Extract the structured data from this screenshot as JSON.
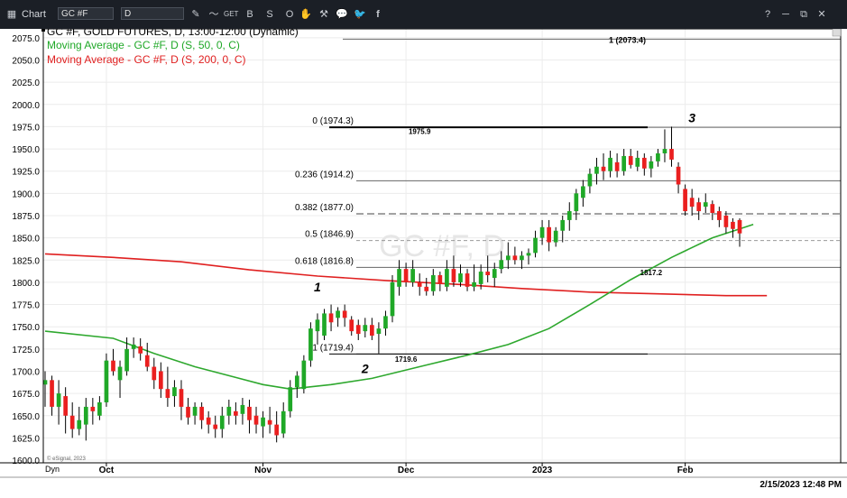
{
  "toolbar": {
    "window_title": "Chart",
    "symbol_value": "GC #F",
    "interval_value": "D",
    "icon_names": [
      "chart-app-icon",
      "pencil-icon",
      "wave-icon",
      "get-icon",
      "b-icon",
      "s-icon",
      "o-icon",
      "hand-icon",
      "tool-icon",
      "comment-icon",
      "twitter-icon",
      "facebook-icon"
    ],
    "icon_labels": [
      "✎",
      "〜",
      "GET",
      "B",
      "S",
      "O",
      "✋",
      "⚒",
      "💬",
      "🐦",
      "f"
    ],
    "window_icons": [
      "?",
      "─",
      "⧉",
      "✕"
    ]
  },
  "legend": {
    "price_line": "GC #F, GOLD FUTURES, D, 13:00-12:00 (Dynamic)",
    "ma50_line": "Moving Average - GC #F, D (S, 50, 0, C)",
    "ma200_line": "Moving Average - GC #F, D (S, 200, 0, C)"
  },
  "footer": {
    "timestamp": "2/15/2023 12:48 PM",
    "copyright": "© eSignal, 2023",
    "dyn_label": "Dyn"
  },
  "colors": {
    "up": "#1fa827",
    "down": "#ea1f1f",
    "ma50": "#2ea82e",
    "ma200": "#e02020",
    "toolbar_bg": "#1b1f26"
  },
  "chart_data": {
    "type": "candlestick",
    "title": "GC #F, GOLD FUTURES, D, 13:00-12:00 (Dynamic)",
    "watermark": "GC #F, D",
    "ylim": [
      1597,
      2085
    ],
    "y_ticks": [
      1600,
      1625,
      1650,
      1675,
      1700,
      1725,
      1750,
      1775,
      1800,
      1825,
      1850,
      1875,
      1900,
      1925,
      1950,
      1975,
      2000,
      2025,
      2050,
      2075
    ],
    "y_tick_labels": [
      "1600.0",
      "1625.0",
      "1650.0",
      "1675.0",
      "1700.0",
      "1725.0",
      "1750.0",
      "1775.0",
      "1800.0",
      "1825.0",
      "1850.0",
      "1875.0",
      "1900.0",
      "1925.0",
      "1950.0",
      "1975.0",
      "2000.0",
      "2025.0",
      "2050.0",
      "2075.0"
    ],
    "x_labels": [
      {
        "label": "Oct",
        "index": 9
      },
      {
        "label": "Nov",
        "index": 32
      },
      {
        "label": "Dec",
        "index": 53
      },
      {
        "label": "2023",
        "index": 73
      },
      {
        "label": "Feb",
        "index": 94
      }
    ],
    "candles": [
      {
        "o": 1685,
        "h": 1700,
        "l": 1660,
        "c": 1690
      },
      {
        "o": 1690,
        "h": 1695,
        "l": 1650,
        "c": 1660
      },
      {
        "o": 1660,
        "h": 1690,
        "l": 1640,
        "c": 1675
      },
      {
        "o": 1672,
        "h": 1682,
        "l": 1630,
        "c": 1650
      },
      {
        "o": 1650,
        "h": 1665,
        "l": 1625,
        "c": 1635
      },
      {
        "o": 1635,
        "h": 1660,
        "l": 1628,
        "c": 1645
      },
      {
        "o": 1640,
        "h": 1670,
        "l": 1622,
        "c": 1660
      },
      {
        "o": 1660,
        "h": 1670,
        "l": 1640,
        "c": 1655
      },
      {
        "o": 1650,
        "h": 1672,
        "l": 1645,
        "c": 1665
      },
      {
        "o": 1665,
        "h": 1720,
        "l": 1660,
        "c": 1712
      },
      {
        "o": 1712,
        "h": 1725,
        "l": 1695,
        "c": 1700
      },
      {
        "o": 1690,
        "h": 1712,
        "l": 1670,
        "c": 1705
      },
      {
        "o": 1700,
        "h": 1738,
        "l": 1695,
        "c": 1725
      },
      {
        "o": 1725,
        "h": 1738,
        "l": 1715,
        "c": 1730
      },
      {
        "o": 1728,
        "h": 1737,
        "l": 1712,
        "c": 1720
      },
      {
        "o": 1718,
        "h": 1732,
        "l": 1700,
        "c": 1705
      },
      {
        "o": 1705,
        "h": 1715,
        "l": 1680,
        "c": 1690
      },
      {
        "o": 1700,
        "h": 1710,
        "l": 1670,
        "c": 1680
      },
      {
        "o": 1680,
        "h": 1705,
        "l": 1660,
        "c": 1670
      },
      {
        "o": 1672,
        "h": 1690,
        "l": 1660,
        "c": 1682
      },
      {
        "o": 1680,
        "h": 1690,
        "l": 1645,
        "c": 1660
      },
      {
        "o": 1660,
        "h": 1670,
        "l": 1640,
        "c": 1648
      },
      {
        "o": 1650,
        "h": 1665,
        "l": 1640,
        "c": 1660
      },
      {
        "o": 1660,
        "h": 1665,
        "l": 1635,
        "c": 1645
      },
      {
        "o": 1648,
        "h": 1655,
        "l": 1630,
        "c": 1640
      },
      {
        "o": 1640,
        "h": 1650,
        "l": 1625,
        "c": 1635
      },
      {
        "o": 1635,
        "h": 1660,
        "l": 1625,
        "c": 1650
      },
      {
        "o": 1650,
        "h": 1668,
        "l": 1640,
        "c": 1660
      },
      {
        "o": 1655,
        "h": 1665,
        "l": 1640,
        "c": 1650
      },
      {
        "o": 1652,
        "h": 1670,
        "l": 1640,
        "c": 1662
      },
      {
        "o": 1660,
        "h": 1668,
        "l": 1630,
        "c": 1645
      },
      {
        "o": 1650,
        "h": 1660,
        "l": 1630,
        "c": 1640
      },
      {
        "o": 1638,
        "h": 1655,
        "l": 1625,
        "c": 1648
      },
      {
        "o": 1645,
        "h": 1660,
        "l": 1630,
        "c": 1640
      },
      {
        "o": 1640,
        "h": 1655,
        "l": 1620,
        "c": 1628
      },
      {
        "o": 1630,
        "h": 1665,
        "l": 1625,
        "c": 1655
      },
      {
        "o": 1655,
        "h": 1690,
        "l": 1648,
        "c": 1682
      },
      {
        "o": 1682,
        "h": 1700,
        "l": 1670,
        "c": 1695
      },
      {
        "o": 1680,
        "h": 1718,
        "l": 1675,
        "c": 1712
      },
      {
        "o": 1712,
        "h": 1755,
        "l": 1705,
        "c": 1748
      },
      {
        "o": 1745,
        "h": 1765,
        "l": 1730,
        "c": 1758
      },
      {
        "o": 1740,
        "h": 1770,
        "l": 1735,
        "c": 1765
      },
      {
        "o": 1765,
        "h": 1775,
        "l": 1745,
        "c": 1755
      },
      {
        "o": 1760,
        "h": 1772,
        "l": 1750,
        "c": 1768
      },
      {
        "o": 1768,
        "h": 1775,
        "l": 1750,
        "c": 1760
      },
      {
        "o": 1758,
        "h": 1762,
        "l": 1740,
        "c": 1745
      },
      {
        "o": 1752,
        "h": 1758,
        "l": 1735,
        "c": 1742
      },
      {
        "o": 1745,
        "h": 1760,
        "l": 1738,
        "c": 1752
      },
      {
        "o": 1752,
        "h": 1760,
        "l": 1735,
        "c": 1740
      },
      {
        "o": 1742,
        "h": 1755,
        "l": 1720,
        "c": 1748
      },
      {
        "o": 1748,
        "h": 1768,
        "l": 1740,
        "c": 1762
      },
      {
        "o": 1762,
        "h": 1808,
        "l": 1755,
        "c": 1800
      },
      {
        "o": 1795,
        "h": 1825,
        "l": 1785,
        "c": 1815
      },
      {
        "o": 1815,
        "h": 1822,
        "l": 1795,
        "c": 1800
      },
      {
        "o": 1800,
        "h": 1825,
        "l": 1795,
        "c": 1815
      },
      {
        "o": 1800,
        "h": 1810,
        "l": 1785,
        "c": 1795
      },
      {
        "o": 1795,
        "h": 1805,
        "l": 1785,
        "c": 1790
      },
      {
        "o": 1790,
        "h": 1815,
        "l": 1785,
        "c": 1808
      },
      {
        "o": 1808,
        "h": 1812,
        "l": 1790,
        "c": 1798
      },
      {
        "o": 1795,
        "h": 1825,
        "l": 1790,
        "c": 1815
      },
      {
        "o": 1815,
        "h": 1830,
        "l": 1795,
        "c": 1800
      },
      {
        "o": 1800,
        "h": 1820,
        "l": 1795,
        "c": 1810
      },
      {
        "o": 1810,
        "h": 1815,
        "l": 1790,
        "c": 1795
      },
      {
        "o": 1795,
        "h": 1820,
        "l": 1790,
        "c": 1800
      },
      {
        "o": 1798,
        "h": 1820,
        "l": 1792,
        "c": 1812
      },
      {
        "o": 1812,
        "h": 1830,
        "l": 1800,
        "c": 1808
      },
      {
        "o": 1805,
        "h": 1822,
        "l": 1795,
        "c": 1815
      },
      {
        "o": 1815,
        "h": 1835,
        "l": 1810,
        "c": 1825
      },
      {
        "o": 1825,
        "h": 1845,
        "l": 1815,
        "c": 1830
      },
      {
        "o": 1830,
        "h": 1840,
        "l": 1820,
        "c": 1825
      },
      {
        "o": 1825,
        "h": 1835,
        "l": 1815,
        "c": 1830
      },
      {
        "o": 1830,
        "h": 1838,
        "l": 1820,
        "c": 1833
      },
      {
        "o": 1833,
        "h": 1858,
        "l": 1828,
        "c": 1850
      },
      {
        "o": 1850,
        "h": 1870,
        "l": 1842,
        "c": 1862
      },
      {
        "o": 1862,
        "h": 1870,
        "l": 1835,
        "c": 1845
      },
      {
        "o": 1845,
        "h": 1862,
        "l": 1840,
        "c": 1858
      },
      {
        "o": 1858,
        "h": 1875,
        "l": 1845,
        "c": 1870
      },
      {
        "o": 1870,
        "h": 1890,
        "l": 1858,
        "c": 1880
      },
      {
        "o": 1880,
        "h": 1905,
        "l": 1870,
        "c": 1900
      },
      {
        "o": 1895,
        "h": 1915,
        "l": 1885,
        "c": 1908
      },
      {
        "o": 1908,
        "h": 1928,
        "l": 1900,
        "c": 1922
      },
      {
        "o": 1922,
        "h": 1940,
        "l": 1910,
        "c": 1930
      },
      {
        "o": 1930,
        "h": 1945,
        "l": 1915,
        "c": 1925
      },
      {
        "o": 1925,
        "h": 1948,
        "l": 1918,
        "c": 1940
      },
      {
        "o": 1935,
        "h": 1945,
        "l": 1918,
        "c": 1925
      },
      {
        "o": 1925,
        "h": 1950,
        "l": 1920,
        "c": 1942
      },
      {
        "o": 1942,
        "h": 1950,
        "l": 1928,
        "c": 1932
      },
      {
        "o": 1930,
        "h": 1948,
        "l": 1925,
        "c": 1940
      },
      {
        "o": 1940,
        "h": 1945,
        "l": 1920,
        "c": 1928
      },
      {
        "o": 1928,
        "h": 1942,
        "l": 1918,
        "c": 1936
      },
      {
        "o": 1936,
        "h": 1950,
        "l": 1930,
        "c": 1945
      },
      {
        "o": 1945,
        "h": 1972,
        "l": 1935,
        "c": 1950
      },
      {
        "o": 1950,
        "h": 1975,
        "l": 1930,
        "c": 1938
      },
      {
        "o": 1930,
        "h": 1935,
        "l": 1900,
        "c": 1910
      },
      {
        "o": 1905,
        "h": 1910,
        "l": 1875,
        "c": 1880
      },
      {
        "o": 1895,
        "h": 1905,
        "l": 1875,
        "c": 1885
      },
      {
        "o": 1890,
        "h": 1895,
        "l": 1870,
        "c": 1880
      },
      {
        "o": 1885,
        "h": 1900,
        "l": 1878,
        "c": 1890
      },
      {
        "o": 1888,
        "h": 1892,
        "l": 1870,
        "c": 1878
      },
      {
        "o": 1880,
        "h": 1885,
        "l": 1862,
        "c": 1870
      },
      {
        "o": 1875,
        "h": 1880,
        "l": 1855,
        "c": 1862
      },
      {
        "o": 1868,
        "h": 1872,
        "l": 1850,
        "c": 1860
      },
      {
        "o": 1870,
        "h": 1872,
        "l": 1840,
        "c": 1855
      }
    ],
    "ma50": [
      {
        "i": 0,
        "v": 1745
      },
      {
        "i": 10,
        "v": 1737
      },
      {
        "i": 16,
        "v": 1720
      },
      {
        "i": 22,
        "v": 1705
      },
      {
        "i": 28,
        "v": 1693
      },
      {
        "i": 32,
        "v": 1685
      },
      {
        "i": 36,
        "v": 1680
      },
      {
        "i": 42,
        "v": 1685
      },
      {
        "i": 48,
        "v": 1692
      },
      {
        "i": 56,
        "v": 1707
      },
      {
        "i": 62,
        "v": 1718
      },
      {
        "i": 68,
        "v": 1730
      },
      {
        "i": 74,
        "v": 1748
      },
      {
        "i": 80,
        "v": 1775
      },
      {
        "i": 86,
        "v": 1803
      },
      {
        "i": 92,
        "v": 1828
      },
      {
        "i": 98,
        "v": 1850
      },
      {
        "i": 104,
        "v": 1865
      }
    ],
    "ma200": [
      {
        "i": 0,
        "v": 1832
      },
      {
        "i": 10,
        "v": 1828
      },
      {
        "i": 20,
        "v": 1823
      },
      {
        "i": 30,
        "v": 1814
      },
      {
        "i": 40,
        "v": 1807
      },
      {
        "i": 50,
        "v": 1802
      },
      {
        "i": 60,
        "v": 1798
      },
      {
        "i": 70,
        "v": 1793
      },
      {
        "i": 80,
        "v": 1789
      },
      {
        "i": 90,
        "v": 1787
      },
      {
        "i": 100,
        "v": 1785
      },
      {
        "i": 106,
        "v": 1785
      }
    ],
    "fib_levels": [
      {
        "label": "0 (1974.3)",
        "value": 1974.3,
        "style": "solid"
      },
      {
        "label": "0.236 (1914.2)",
        "value": 1914.2,
        "style": "solid"
      },
      {
        "label": "0.382 (1877.0)",
        "value": 1877.0,
        "style": "dashed"
      },
      {
        "label": "0.5 (1846.9)",
        "value": 1846.9,
        "style": "dashed-light"
      },
      {
        "label": "0.618 (1816.8)",
        "value": 1816.8,
        "style": "solid"
      },
      {
        "label": "1 (1719.4)",
        "value": 1719.4,
        "style": "solid"
      }
    ],
    "top_level": {
      "label": "1 (2073.4)",
      "value": 2073.4
    },
    "annotations": [
      {
        "text": "1975.9",
        "value": 1975.9,
        "index": 55,
        "type": "price"
      },
      {
        "text": "1817.2",
        "value": 1817.2,
        "index": 89,
        "type": "price"
      },
      {
        "text": "1719.6",
        "value": 1719.6,
        "index": 53,
        "type": "price"
      },
      {
        "text": "1",
        "value": 1790,
        "index": 40,
        "type": "wave"
      },
      {
        "text": "2",
        "value": 1698,
        "index": 47,
        "type": "wave"
      },
      {
        "text": "3",
        "value": 1980,
        "index": 95,
        "type": "wave"
      }
    ]
  }
}
